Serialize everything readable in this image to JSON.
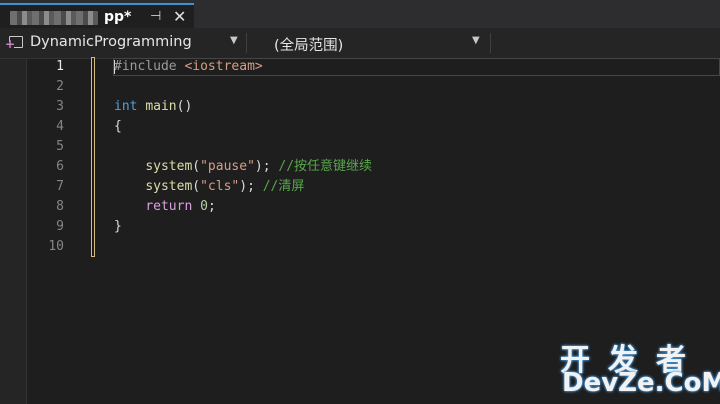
{
  "tab": {
    "title": "pp*",
    "pin_glyph": "⊣",
    "close_glyph": "✕"
  },
  "navbar": {
    "project": "DynamicProgramming",
    "scope": "(全局范围)",
    "member": ""
  },
  "editor": {
    "line_numbers": [
      "1",
      "2",
      "3",
      "4",
      "5",
      "6",
      "7",
      "8",
      "9",
      "10"
    ],
    "current_line": "1",
    "lines": {
      "l1_directive": "#include",
      "l1_header": "<iostream>",
      "l3_kw": "int",
      "l3_fn": "main",
      "l3_rest": "()",
      "l4": "{",
      "l6_fn": "system",
      "l6_open": "(",
      "l6_str": "\"pause\"",
      "l6_close": ");",
      "l6_cmt": "//按任意键继续",
      "l7_fn": "system",
      "l7_open": "(",
      "l7_str": "\"cls\"",
      "l7_close": ");",
      "l7_cmt": "//清屏",
      "l8_kw": "return",
      "l8_num": "0",
      "l8_end": ";",
      "l9": "}"
    }
  },
  "watermark": {
    "top": "开发者",
    "bottom": "DevZe.CoM"
  },
  "colors": {
    "accent": "#3f8fd8",
    "keyword": "#569cd6",
    "comment": "#57a64a",
    "string": "#d69d85",
    "change_bar": "#d7ba7d"
  }
}
